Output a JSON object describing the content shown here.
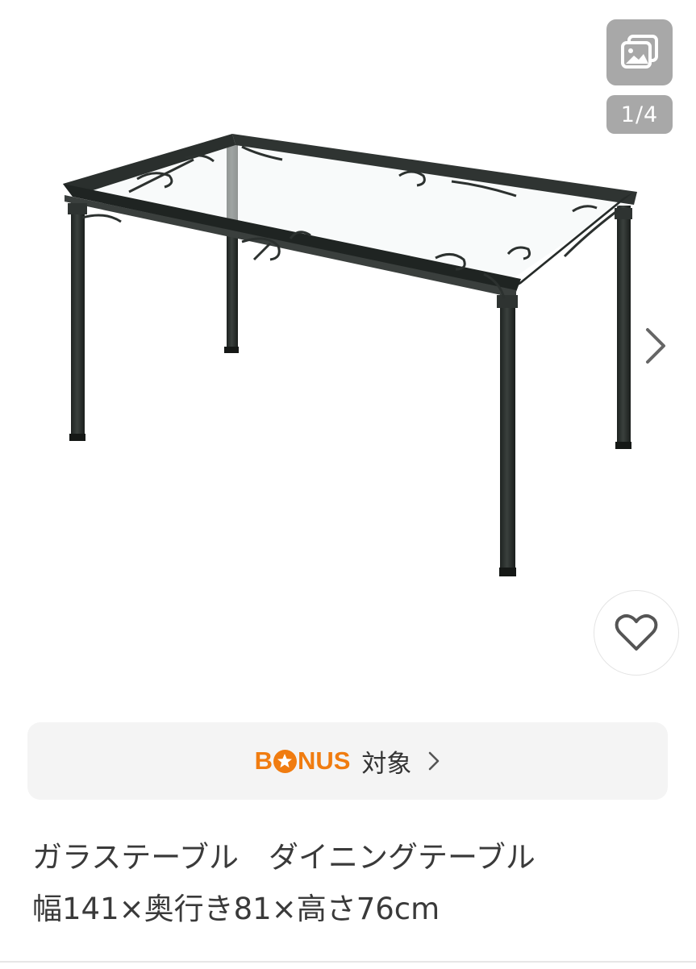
{
  "carousel": {
    "page_indicator": "1/4",
    "gallery_icon": "image-gallery-icon",
    "next_icon": "chevron-right-icon",
    "favorite_icon": "heart-icon"
  },
  "bonus": {
    "logo_text_prefix": "B",
    "logo_text_suffix": "NUS",
    "label": "対象",
    "accent_color": "#f07c10",
    "chevron_icon": "chevron-right-icon"
  },
  "product": {
    "title": "ガラステーブル　ダイニングテーブル\n幅141×奥行き81×高さ76cm"
  }
}
